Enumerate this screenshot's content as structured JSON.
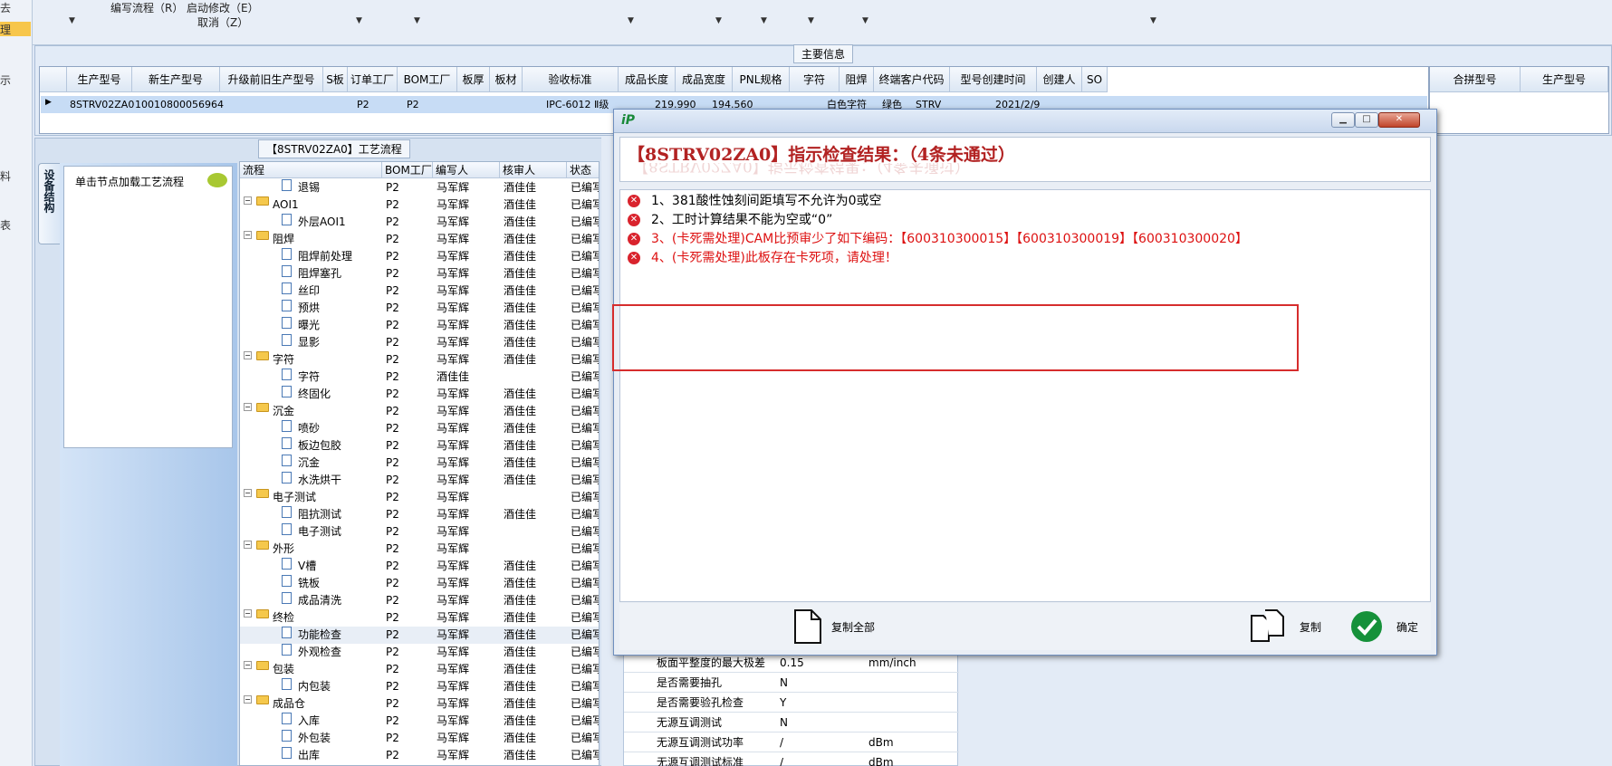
{
  "toolbar": {
    "left_label": "去",
    "items": [
      "编写流程（R）",
      "启动修改（E）",
      "取消（Z）"
    ]
  },
  "left_strip": [
    "理",
    "示",
    "料",
    "表"
  ],
  "main_info": {
    "title": "主要信息",
    "columns": [
      "生产型号",
      "新生产型号",
      "升级前旧生产型号",
      "S板",
      "订单工厂",
      "BOM工厂",
      "板厚",
      "板材",
      "验收标准",
      "成品长度",
      "成品宽度",
      "PNL规格",
      "字符",
      "阻焊",
      "终端客户代码",
      "型号创建时间",
      "创建人",
      "SO"
    ],
    "row": [
      "8STRV02ZA0",
      "10010800056964",
      "",
      "",
      "P2",
      "P2",
      "",
      "",
      "IPC-6012 Ⅱ级",
      "219.990",
      "194.560",
      "",
      "白色字符",
      "绿色",
      "STRV",
      "2021/2/9",
      "",
      ""
    ],
    "right_columns": [
      "合拼型号",
      "生产型号"
    ]
  },
  "process_flow": {
    "title": "【8STRV02ZA0】工艺流程",
    "vertical_tab": "设备结构",
    "node_hint": "单击节点加载工艺流程",
    "columns": [
      "流程",
      "BOM工厂",
      "编写人",
      "核审人",
      "状态"
    ],
    "rows": [
      {
        "name": "退锡",
        "level": 2,
        "folder": false,
        "bom": "P2",
        "writer": "马军辉",
        "reviewer": "酒佳佳",
        "status": "已编写"
      },
      {
        "name": "AOI1",
        "level": 1,
        "folder": true,
        "bom": "P2",
        "writer": "马军辉",
        "reviewer": "酒佳佳",
        "status": "已编写"
      },
      {
        "name": "外层AOI1",
        "level": 2,
        "folder": false,
        "bom": "P2",
        "writer": "马军辉",
        "reviewer": "酒佳佳",
        "status": "已编写"
      },
      {
        "name": "阻焊",
        "level": 1,
        "folder": true,
        "bom": "P2",
        "writer": "马军辉",
        "reviewer": "酒佳佳",
        "status": "已编写"
      },
      {
        "name": "阻焊前处理",
        "level": 2,
        "folder": false,
        "bom": "P2",
        "writer": "马军辉",
        "reviewer": "酒佳佳",
        "status": "已编写"
      },
      {
        "name": "阻焊塞孔",
        "level": 2,
        "folder": false,
        "bom": "P2",
        "writer": "马军辉",
        "reviewer": "酒佳佳",
        "status": "已编写"
      },
      {
        "name": "丝印",
        "level": 2,
        "folder": false,
        "bom": "P2",
        "writer": "马军辉",
        "reviewer": "酒佳佳",
        "status": "已编写"
      },
      {
        "name": "预烘",
        "level": 2,
        "folder": false,
        "bom": "P2",
        "writer": "马军辉",
        "reviewer": "酒佳佳",
        "status": "已编写"
      },
      {
        "name": "曝光",
        "level": 2,
        "folder": false,
        "bom": "P2",
        "writer": "马军辉",
        "reviewer": "酒佳佳",
        "status": "已编写"
      },
      {
        "name": "显影",
        "level": 2,
        "folder": false,
        "bom": "P2",
        "writer": "马军辉",
        "reviewer": "酒佳佳",
        "status": "已编写"
      },
      {
        "name": "字符",
        "level": 1,
        "folder": true,
        "bom": "P2",
        "writer": "马军辉",
        "reviewer": "酒佳佳",
        "status": "已编写"
      },
      {
        "name": "字符",
        "level": 2,
        "folder": false,
        "bom": "P2",
        "writer": "酒佳佳",
        "reviewer": "",
        "status": "已编写"
      },
      {
        "name": "终固化",
        "level": 2,
        "folder": false,
        "bom": "P2",
        "writer": "马军辉",
        "reviewer": "酒佳佳",
        "status": "已编写"
      },
      {
        "name": "沉金",
        "level": 1,
        "folder": true,
        "bom": "P2",
        "writer": "马军辉",
        "reviewer": "酒佳佳",
        "status": "已编写"
      },
      {
        "name": "喷砂",
        "level": 2,
        "folder": false,
        "bom": "P2",
        "writer": "马军辉",
        "reviewer": "酒佳佳",
        "status": "已编写"
      },
      {
        "name": "板边包胶",
        "level": 2,
        "folder": false,
        "bom": "P2",
        "writer": "马军辉",
        "reviewer": "酒佳佳",
        "status": "已编写"
      },
      {
        "name": "沉金",
        "level": 2,
        "folder": false,
        "bom": "P2",
        "writer": "马军辉",
        "reviewer": "酒佳佳",
        "status": "已编写"
      },
      {
        "name": "水洗烘干",
        "level": 2,
        "folder": false,
        "bom": "P2",
        "writer": "马军辉",
        "reviewer": "酒佳佳",
        "status": "已编写"
      },
      {
        "name": "电子测试",
        "level": 1,
        "folder": true,
        "bom": "P2",
        "writer": "马军辉",
        "reviewer": "",
        "status": "已编写"
      },
      {
        "name": "阻抗测试",
        "level": 2,
        "folder": false,
        "bom": "P2",
        "writer": "马军辉",
        "reviewer": "酒佳佳",
        "status": "已编写"
      },
      {
        "name": "电子测试",
        "level": 2,
        "folder": false,
        "bom": "P2",
        "writer": "马军辉",
        "reviewer": "",
        "status": "已编写"
      },
      {
        "name": "外形",
        "level": 1,
        "folder": true,
        "bom": "P2",
        "writer": "马军辉",
        "reviewer": "",
        "status": "已编写"
      },
      {
        "name": "V槽",
        "level": 2,
        "folder": false,
        "bom": "P2",
        "writer": "马军辉",
        "reviewer": "酒佳佳",
        "status": "已编写"
      },
      {
        "name": "铣板",
        "level": 2,
        "folder": false,
        "bom": "P2",
        "writer": "马军辉",
        "reviewer": "酒佳佳",
        "status": "已编写"
      },
      {
        "name": "成品清洗",
        "level": 2,
        "folder": false,
        "bom": "P2",
        "writer": "马军辉",
        "reviewer": "酒佳佳",
        "status": "已编写"
      },
      {
        "name": "终检",
        "level": 1,
        "folder": true,
        "bom": "P2",
        "writer": "马军辉",
        "reviewer": "酒佳佳",
        "status": "已编写"
      },
      {
        "name": "功能检查",
        "level": 2,
        "folder": false,
        "bom": "P2",
        "writer": "马军辉",
        "reviewer": "酒佳佳",
        "status": "已编写"
      },
      {
        "name": "外观检查",
        "level": 2,
        "folder": false,
        "bom": "P2",
        "writer": "马军辉",
        "reviewer": "酒佳佳",
        "status": "已编写"
      },
      {
        "name": "包装",
        "level": 1,
        "folder": true,
        "bom": "P2",
        "writer": "马军辉",
        "reviewer": "酒佳佳",
        "status": "已编写"
      },
      {
        "name": "内包装",
        "level": 2,
        "folder": false,
        "bom": "P2",
        "writer": "马军辉",
        "reviewer": "酒佳佳",
        "status": "已编写"
      },
      {
        "name": "成品仓",
        "level": 1,
        "folder": true,
        "bom": "P2",
        "writer": "马军辉",
        "reviewer": "酒佳佳",
        "status": "已编写"
      },
      {
        "name": "入库",
        "level": 2,
        "folder": false,
        "bom": "P2",
        "writer": "马军辉",
        "reviewer": "酒佳佳",
        "status": "已编写"
      },
      {
        "name": "外包装",
        "level": 2,
        "folder": false,
        "bom": "P2",
        "writer": "马军辉",
        "reviewer": "酒佳佳",
        "status": "已编写"
      },
      {
        "name": "出库",
        "level": 2,
        "folder": false,
        "bom": "P2",
        "writer": "马军辉",
        "reviewer": "酒佳佳",
        "status": "已编写"
      }
    ]
  },
  "params_table": [
    {
      "name": "板面平整度的最大极差",
      "value": "0.15",
      "unit": "mm/inch"
    },
    {
      "name": "是否需要抽孔",
      "value": "N",
      "unit": ""
    },
    {
      "name": "是否需要验孔检查",
      "value": "Y",
      "unit": ""
    },
    {
      "name": "无源互调测试",
      "value": "N",
      "unit": ""
    },
    {
      "name": "无源互调测试功率",
      "value": "/",
      "unit": "dBm"
    },
    {
      "name": "无源互调测试标准",
      "value": "/",
      "unit": "dBm"
    }
  ],
  "dialog": {
    "heading": "【8STRV02ZA0】指示检查结果：（4条未通过）",
    "errors": [
      {
        "text": "1、381酸性蚀刻间距填写不允许为0或空",
        "critical": false
      },
      {
        "text": "2、工时计算结果不能为空或“0”",
        "critical": false
      },
      {
        "text": "3、(卡死需处理)CAM比预审少了如下编码：【600310300015】【600310300019】【600310300020】",
        "critical": true
      },
      {
        "text": "4、(卡死需处理)此板存在卡死项，请处理！",
        "critical": true
      }
    ],
    "copy_all_label": "复制全部",
    "copy_label": "复制",
    "ok_label": "确定"
  }
}
